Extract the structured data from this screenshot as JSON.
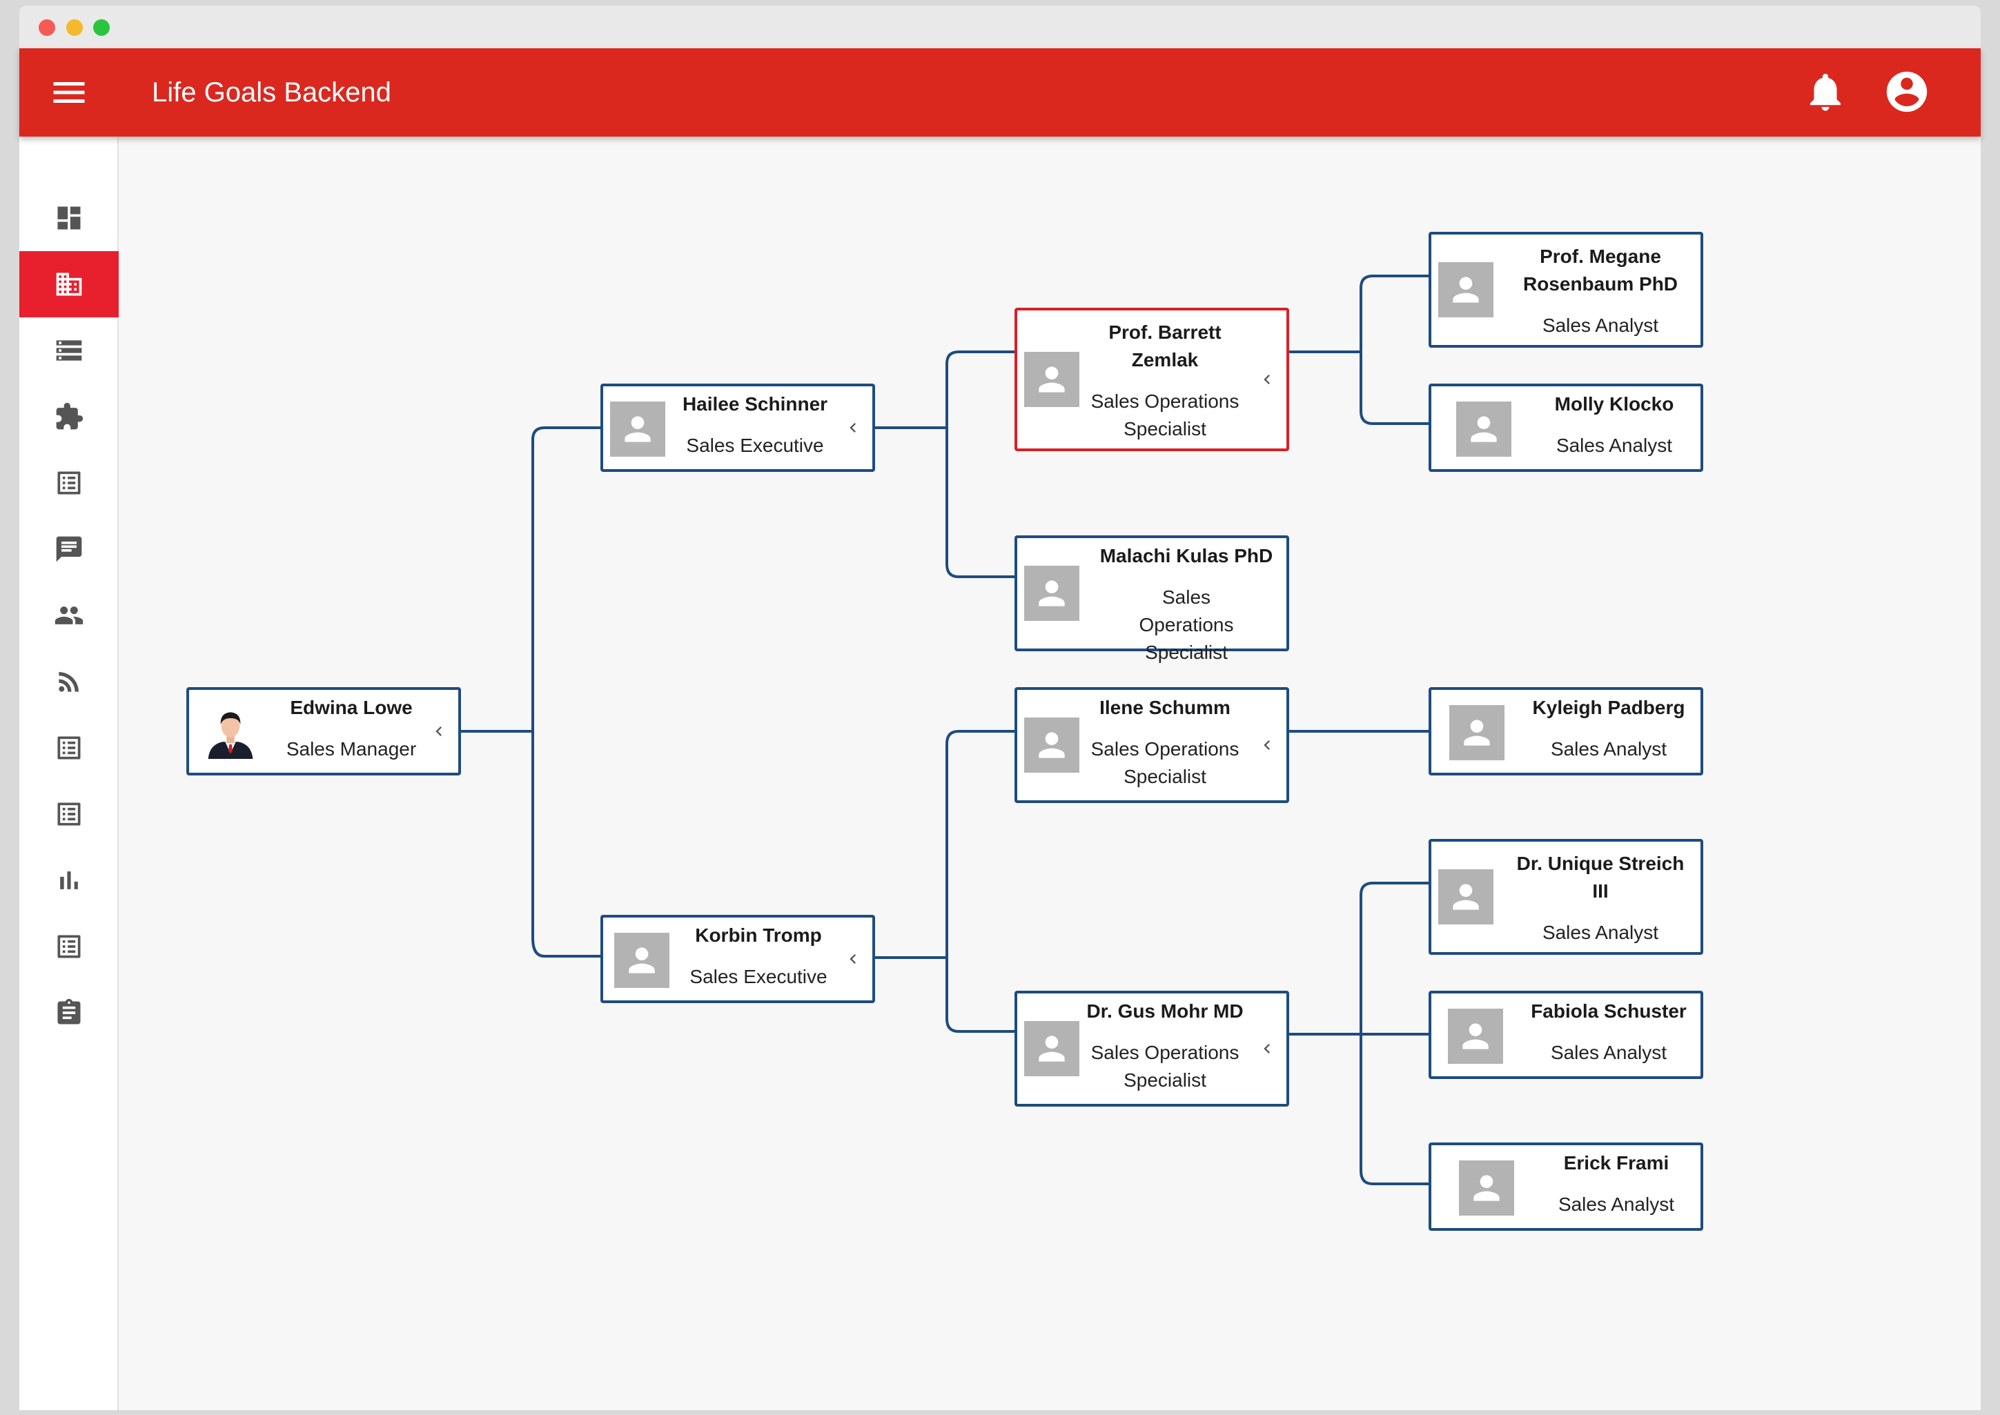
{
  "app": {
    "title": "Life Goals Backend",
    "accent": "#da281f",
    "active_nav": "#e8202e",
    "node_border": "#1e4c7e",
    "selected_border": "#da1f26"
  },
  "sidebar": {
    "items": [
      {
        "icon": "dashboard-icon",
        "active": false
      },
      {
        "icon": "business-icon",
        "active": true
      },
      {
        "icon": "storage-icon",
        "active": false
      },
      {
        "icon": "extension-icon",
        "active": false
      },
      {
        "icon": "list-icon",
        "active": false
      },
      {
        "icon": "chat-icon",
        "active": false
      },
      {
        "icon": "people-icon",
        "active": false
      },
      {
        "icon": "rss-feed-icon",
        "active": false
      },
      {
        "icon": "list-icon",
        "active": false
      },
      {
        "icon": "list-icon",
        "active": false
      },
      {
        "icon": "bar-chart-icon",
        "active": false
      },
      {
        "icon": "list-icon",
        "active": false
      },
      {
        "icon": "assignment-icon",
        "active": false
      }
    ]
  },
  "org": {
    "edwina": {
      "name": "Edwina Lowe",
      "role": "Sales Manager"
    },
    "hailee": {
      "name": "Hailee Schinner",
      "role": "Sales Executive"
    },
    "korbin": {
      "name": "Korbin Tromp",
      "role": "Sales Executive"
    },
    "barrett": {
      "name": "Prof. Barrett Zemlak",
      "role": "Sales Operations Specialist"
    },
    "malachi": {
      "name": "Malachi Kulas PhD",
      "role": "Sales Operations Specialist"
    },
    "ilene": {
      "name": "Ilene Schumm",
      "role": "Sales Operations Specialist"
    },
    "gus": {
      "name": "Dr. Gus Mohr MD",
      "role": "Sales Operations Specialist"
    },
    "megane": {
      "name": "Prof. Megane Rosenbaum PhD",
      "role": "Sales Analyst"
    },
    "molly": {
      "name": "Molly Klocko",
      "role": "Sales Analyst"
    },
    "kyleigh": {
      "name": "Kyleigh Padberg",
      "role": "Sales Analyst"
    },
    "unique": {
      "name": "Dr. Unique Streich III",
      "role": "Sales Analyst"
    },
    "fabiola": {
      "name": "Fabiola Schuster",
      "role": "Sales Analyst"
    },
    "erick": {
      "name": "Erick Frami",
      "role": "Sales Analyst"
    }
  }
}
